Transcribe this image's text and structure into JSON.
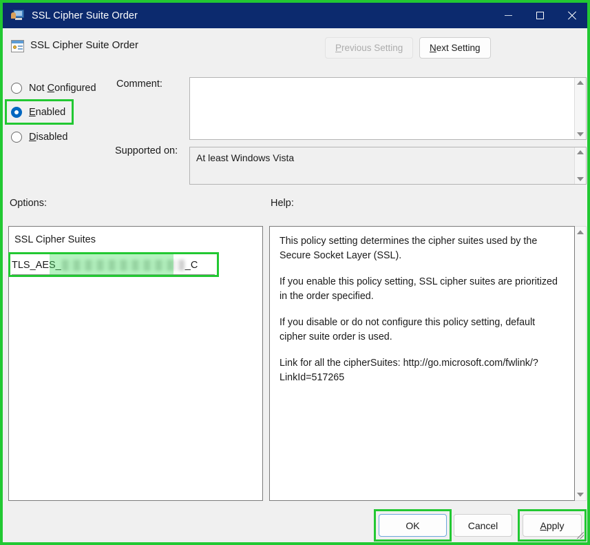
{
  "window": {
    "title": "SSL Cipher Suite Order",
    "icon": "policy-computer-icon",
    "controls": {
      "minimize": "minimize-icon",
      "maximize": "maximize-icon",
      "close": "close-icon"
    }
  },
  "header": {
    "icon": "policy-setting-icon",
    "title": "SSL Cipher Suite Order",
    "previous_setting": "Previous Setting",
    "previous_accel": "P",
    "previous_rest": "revious Setting",
    "next_accel": "N",
    "next_rest": "ext Setting"
  },
  "state": {
    "options": [
      {
        "id": "not-configured",
        "label_accel": "C",
        "label_before": "Not ",
        "label_after": "onfigured",
        "selected": false
      },
      {
        "id": "enabled",
        "label_accel": "E",
        "label_before": "",
        "label_after": "nabled",
        "selected": true
      },
      {
        "id": "disabled",
        "label_accel": "D",
        "label_before": "",
        "label_after": "isabled",
        "selected": false
      }
    ]
  },
  "comment": {
    "label": "Comment:",
    "value": "",
    "placeholder": ""
  },
  "supported_on": {
    "label": "Supported on:",
    "value": "At least Windows Vista"
  },
  "options_panel": {
    "label": "Options:",
    "list_title": "SSL Cipher Suites",
    "cipher_value_prefix": "TLS_AES_",
    "cipher_value_suffix": "_C",
    "cipher_redacted": true
  },
  "help_panel": {
    "label": "Help:",
    "paragraphs": [
      "This policy setting determines the cipher suites used by the Secure Socket Layer (SSL).",
      "If you enable this policy setting, SSL cipher suites are prioritized in the order specified.",
      "If you disable or do not configure this policy setting, default cipher suite order is used.",
      "Link for all the cipherSuites: http://go.microsoft.com/fwlink/?LinkId=517265"
    ]
  },
  "footer": {
    "ok": "OK",
    "cancel": "Cancel",
    "apply_accel": "A",
    "apply_rest": "pply"
  },
  "annotations": {
    "color": "#22C832",
    "highlighted": [
      "enabled-radio",
      "cipher-input",
      "ok-button",
      "apply-button"
    ]
  }
}
